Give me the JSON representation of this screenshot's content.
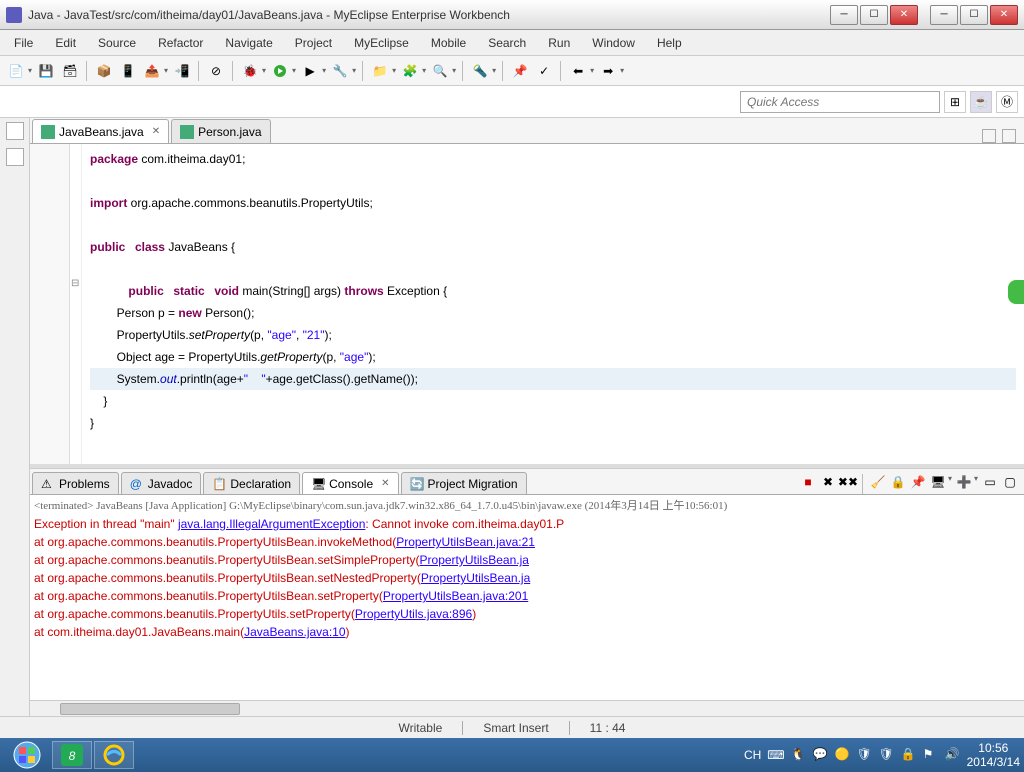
{
  "title": "Java - JavaTest/src/com/itheima/day01/JavaBeans.java - MyEclipse Enterprise Workbench",
  "menu": [
    "File",
    "Edit",
    "Source",
    "Refactor",
    "Navigate",
    "Project",
    "MyEclipse",
    "Mobile",
    "Search",
    "Run",
    "Window",
    "Help"
  ],
  "quick_access_placeholder": "Quick Access",
  "tabs": [
    {
      "label": "JavaBeans.java",
      "active": true
    },
    {
      "label": "Person.java",
      "active": false
    }
  ],
  "code": {
    "l1a": "package",
    "l1b": " com.itheima.day01;",
    "l3a": "import",
    "l3b": " org.apache.commons.beanutils.PropertyUtils;",
    "l5a": "public",
    "l5b": "class",
    "l5c": " JavaBeans {",
    "l7a": "public",
    "l7b": "static",
    "l7c": "void",
    "l7d": " main(String[] args) ",
    "l7e": "throws",
    "l7f": " Exception {",
    "l8a": "        Person p = ",
    "l8b": "new",
    "l8c": " Person();",
    "l9a": "        PropertyUtils.",
    "l9b": "setProperty",
    "l9c": "(p, ",
    "l9d": "\"age\"",
    "l9e": ", ",
    "l9f": "\"21\"",
    "l9g": ");",
    "l10a": "        Object age = PropertyUtils.",
    "l10b": "getProperty",
    "l10c": "(p, ",
    "l10d": "\"age\"",
    "l10e": ");",
    "l11a": "        System.",
    "l11b": "out",
    "l11c": ".println(age+",
    "l11d": "\"    \"",
    "l11e": "+age.getClass().getName());",
    "l12": "    }",
    "l13": "}"
  },
  "bottom_tabs": [
    {
      "icon": "problems",
      "label": "Problems"
    },
    {
      "icon": "javadoc",
      "label": "Javadoc"
    },
    {
      "icon": "declaration",
      "label": "Declaration"
    },
    {
      "icon": "console",
      "label": "Console",
      "active": true
    },
    {
      "icon": "migration",
      "label": "Project Migration"
    }
  ],
  "console_header": "<terminated> JavaBeans [Java Application] G:\\MyEclipse\\binary\\com.sun.java.jdk7.win32.x86_64_1.7.0.u45\\bin\\javaw.exe (2014年3月14日 上午10:56:01)",
  "stack": {
    "l1a": "Exception in thread \"main\" ",
    "l1b": "java.lang.IllegalArgumentException",
    "l1c": ": Cannot invoke com.itheima.day01.P",
    "l2a": "        at org.apache.commons.beanutils.PropertyUtilsBean.invokeMethod(",
    "l2b": "PropertyUtilsBean.java:21",
    "l3a": "        at org.apache.commons.beanutils.PropertyUtilsBean.setSimpleProperty(",
    "l3b": "PropertyUtilsBean.ja",
    "l4a": "        at org.apache.commons.beanutils.PropertyUtilsBean.setNestedProperty(",
    "l4b": "PropertyUtilsBean.ja",
    "l5a": "        at org.apache.commons.beanutils.PropertyUtilsBean.setProperty(",
    "l5b": "PropertyUtilsBean.java:201",
    "l6a": "        at org.apache.commons.beanutils.PropertyUtils.setProperty(",
    "l6b": "PropertyUtils.java:896",
    "l6c": ")",
    "l7a": "        at com.itheima.day01.JavaBeans.main(",
    "l7b": "JavaBeans.java:10",
    "l7c": ")"
  },
  "status": {
    "writable": "Writable",
    "insert": "Smart Insert",
    "pos": "11 : 44"
  },
  "tray": {
    "ime": "CH",
    "time": "10:56",
    "date": "2014/3/14"
  }
}
